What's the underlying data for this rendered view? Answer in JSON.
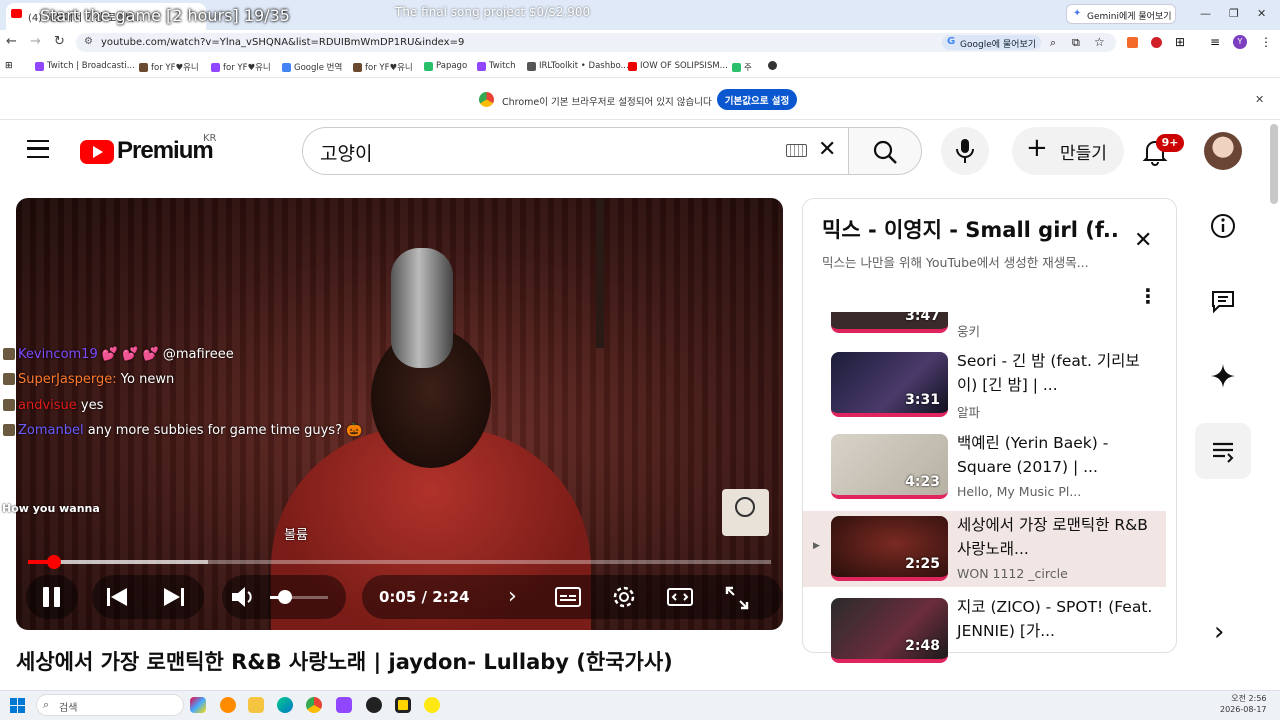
{
  "browser": {
    "tab_title": "(4) 세상에서 가장 로맨틱...",
    "gemini_tab": "Gemini에게 물어보기",
    "url": "youtube.com/watch?v=Ylna_vSHQNA&list=RDUIBmWmDP1RU&index=9",
    "google_query": "Google에 물어보기",
    "bookmarks": [
      "Twitch | Broadcasti...",
      "for YF♥유니",
      "for YF♥유니",
      "Google 번역",
      "for YF♥유니",
      "Papago",
      "Twitch",
      "IRLToolkit • Dashbo...",
      "IOW OF SOLIPSISM...",
      "주"
    ],
    "infobar_text": "Chrome이 기본 브라우저로 설정되어 있지 않습니다",
    "infobar_button": "기본값으로 설정"
  },
  "stream_overlay": {
    "title": "Start the game [2 hours] 19/35",
    "goal": "The final song project $0/$2,900",
    "chat": [
      {
        "user": "Kevincom19",
        "message": "💕 💕 💕 @mafireee",
        "color": "#7d4cff"
      },
      {
        "user": "SuperJasperge:",
        "message": "Yo newn",
        "color": "#ff7a2e"
      },
      {
        "user": "andvisue",
        "message": "yes",
        "color": "#e31b1b"
      },
      {
        "user": "Zomanbel",
        "message": "any more subbies for game time guys? 🎃",
        "color": "#6a5cff"
      }
    ],
    "lyric": "How you wanna"
  },
  "youtube": {
    "brand": "Premium",
    "region": "KR",
    "search_value": "고양이",
    "create_label": "만들기",
    "notifications": "9+"
  },
  "player": {
    "volume_label": "볼륨",
    "time": "0:05 / 2:24",
    "progress": 0.035,
    "volume": 0.25
  },
  "video_title": "세상에서 가장 로맨틱한 R&B 사랑노래 | jaydon- Lullaby (한국가사)",
  "playlist": {
    "title": "믹스 - 이영지 - Small girl (f...",
    "subtitle": "믹스는 나만을 위해 YouTube에서 생성한 재생목...",
    "top_partial": {
      "duration": "3:47",
      "channel": "웅키"
    },
    "items": [
      {
        "title": "Seori - 긴 밤 (feat. 기리보이) [긴 밤] | ...",
        "channel": "알파",
        "duration": "3:31",
        "active": false
      },
      {
        "title": "백예린 (Yerin Baek) - Square (2017) | ...",
        "channel": "Hello, My Music Pl...",
        "duration": "4:23",
        "active": false
      },
      {
        "title": "세상에서 가장 로맨틱한 R&B 사랑노래...",
        "channel": "WON 1112 _circle",
        "duration": "2:25",
        "active": true
      },
      {
        "title": "지코 (ZICO) - SPOT! (Feat. JENNIE) [가...",
        "channel": "",
        "duration": "2:48",
        "active": false
      }
    ]
  },
  "taskbar": {
    "search_placeholder": "검색",
    "time": "오전 2:56",
    "date": "2026-08-17"
  }
}
